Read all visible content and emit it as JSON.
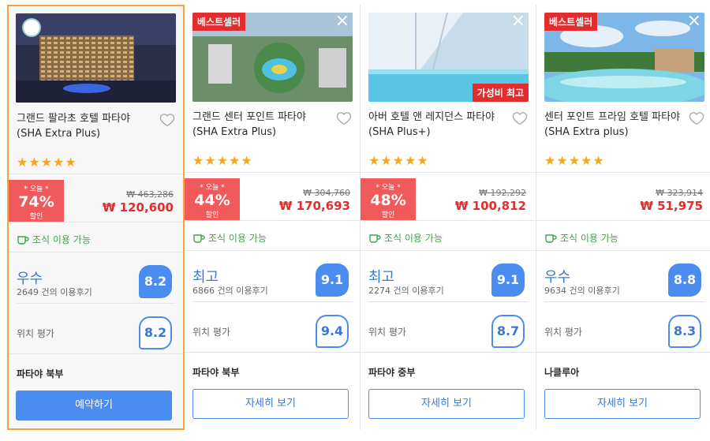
{
  "hotels": [
    {
      "name": "그랜드 팔라초 호텔 파타야 (SHA Extra Plus)",
      "badge": "",
      "value_badge": "",
      "stars": "★★★★★",
      "promo_today": "* 오늘 *",
      "promo_pct": "74%",
      "promo_off": "할인",
      "old_price": "₩ 463,286",
      "price": "₩ 120,600",
      "breakfast": "조식 이용 가능",
      "grade": "우수",
      "reviews": "2649 건의 이용후기",
      "score": "8.2",
      "location_label": "위치 평가",
      "location_score": "8.2",
      "area": "파타야 북부",
      "button": "예약하기"
    },
    {
      "name": "그랜드 센터 포인트 파타야 (SHA Extra Plus)",
      "badge": "베스트셀러",
      "value_badge": "",
      "stars": "★★★★★",
      "promo_today": "* 오늘 *",
      "promo_pct": "44%",
      "promo_off": "할인",
      "old_price": "₩ 304,760",
      "price": "₩ 170,693",
      "breakfast": "조식 이용 가능",
      "grade": "최고",
      "reviews": "6866 건의 이용후기",
      "score": "9.1",
      "location_label": "위치 평가",
      "location_score": "9.4",
      "area": "파타야 북부",
      "button": "자세히 보기"
    },
    {
      "name": "아버 호텔 앤 레지던스 파타야 (SHA Plus+)",
      "badge": "",
      "value_badge": "가성비 최고",
      "stars": "★★★★★",
      "promo_today": "* 오늘 *",
      "promo_pct": "48%",
      "promo_off": "할인",
      "old_price": "₩ 192,292",
      "price": "₩ 100,812",
      "breakfast": "조식 이용 가능",
      "grade": "최고",
      "reviews": "2274 건의 이용후기",
      "score": "9.1",
      "location_label": "위치 평가",
      "location_score": "8.7",
      "area": "파타야 중부",
      "button": "자세히 보기"
    },
    {
      "name": "센터 포인트 프라임 호텔 파타야 (SHA Extra plus)",
      "badge": "베스트셀러",
      "value_badge": "",
      "stars": "★★★★★",
      "promo_today": "",
      "promo_pct": "",
      "promo_off": "",
      "old_price": "₩ 323,914",
      "price": "₩ 51,975",
      "breakfast": "조식 이용 가능",
      "grade": "우수",
      "reviews": "9634 건의 이용후기",
      "score": "8.8",
      "location_label": "위치 평가",
      "location_score": "8.3",
      "area": "나클루아",
      "button": "자세히 보기"
    }
  ],
  "colors": {
    "accent": "#4a8cf0",
    "sale": "#e12d2d",
    "selected_border": "#f8a33a",
    "green": "#3aa64a"
  },
  "icons": {
    "favorite": "heart-icon",
    "breakfast": "coffee-cup-icon",
    "close": "close-icon"
  }
}
